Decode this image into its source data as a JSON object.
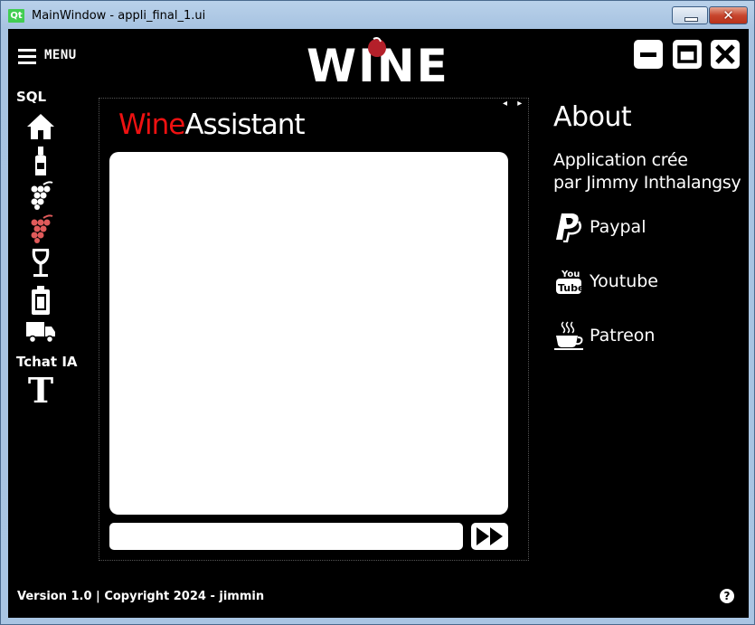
{
  "window": {
    "title": "MainWindow - appli_final_1.ui",
    "qt_badge": "Qt",
    "close_glyph": "✕"
  },
  "header": {
    "menu_label": "MENU",
    "logo_text": "WINE"
  },
  "sidebar": {
    "sql_heading": "SQL",
    "sql_items": [
      "home-icon",
      "bottle-icon",
      "grape-white-icon",
      "grape-red-icon",
      "wine-glass-icon",
      "battery-icon",
      "truck-icon"
    ],
    "chat_heading": "Tchat IA",
    "chat_icon_glyph": "T"
  },
  "chat": {
    "title_part1": "Wine",
    "title_part2": "Assistant",
    "input_value": "",
    "scroll_arrows": "◂ ▸"
  },
  "about": {
    "title": "About",
    "line1": "Application crée",
    "line2": "par Jimmy Inthalangsy",
    "links": [
      "Paypal",
      "Youtube",
      "Patreon"
    ]
  },
  "footer": {
    "text": "Version 1.0 | Copyright 2024 - jimmin",
    "help_glyph": "?"
  },
  "colors": {
    "accent_red": "#ee1111",
    "background": "#000000",
    "grape_red": "#e05a5a"
  }
}
